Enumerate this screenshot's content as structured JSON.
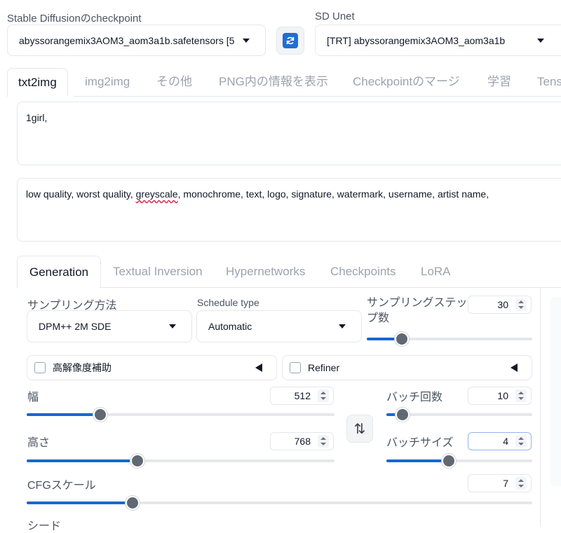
{
  "checkpoint": {
    "label": "Stable Diffusionのcheckpoint",
    "value": "abyssorangemix3AOM3_aom3a1b.safetensors [5"
  },
  "unet": {
    "label": "SD Unet",
    "value": "[TRT] abyssorangemix3AOM3_aom3a1b"
  },
  "main_tabs": [
    "txt2img",
    "img2img",
    "その他",
    "PNG内の情報を表示",
    "Checkpointのマージ",
    "学習",
    "Tens"
  ],
  "prompt": {
    "positive": "1girl,",
    "negative_before": "low quality, worst quality, ",
    "negative_flagged": "greyscale",
    "negative_after": ",  monochrome, text, logo, signature, watermark, username, artist name,"
  },
  "sub_tabs": [
    "Generation",
    "Textual Inversion",
    "Hypernetworks",
    "Checkpoints",
    "LoRA"
  ],
  "sampling": {
    "method_label": "サンプリング方法",
    "method_value": "DPM++ 2M SDE",
    "schedule_label": "Schedule type",
    "schedule_value": "Automatic",
    "steps_label_1": "サンプリングステッ",
    "steps_label_2": "プ数",
    "steps_value": "30",
    "steps_fraction": 0.21
  },
  "hires": {
    "label": "高解像度補助"
  },
  "refiner": {
    "label": "Refiner"
  },
  "width": {
    "label": "幅",
    "value": "512",
    "fraction": 0.24
  },
  "height": {
    "label": "高さ",
    "value": "768",
    "fraction": 0.36
  },
  "batch_count": {
    "label": "バッチ回数",
    "value": "10",
    "fraction": 0.11
  },
  "batch_size": {
    "label": "バッチサイズ",
    "value": "4",
    "fraction": 0.43
  },
  "cfg": {
    "label": "CFGスケール",
    "value": "7",
    "fraction": 0.21
  },
  "seed": {
    "label": "シード"
  },
  "icons": {
    "refresh": "refresh-icon",
    "swap": "swap-dimensions-icon"
  },
  "colors": {
    "accent": "#1967d2",
    "thumb": "#606873",
    "refresh_bg": "#1e6fd8"
  }
}
